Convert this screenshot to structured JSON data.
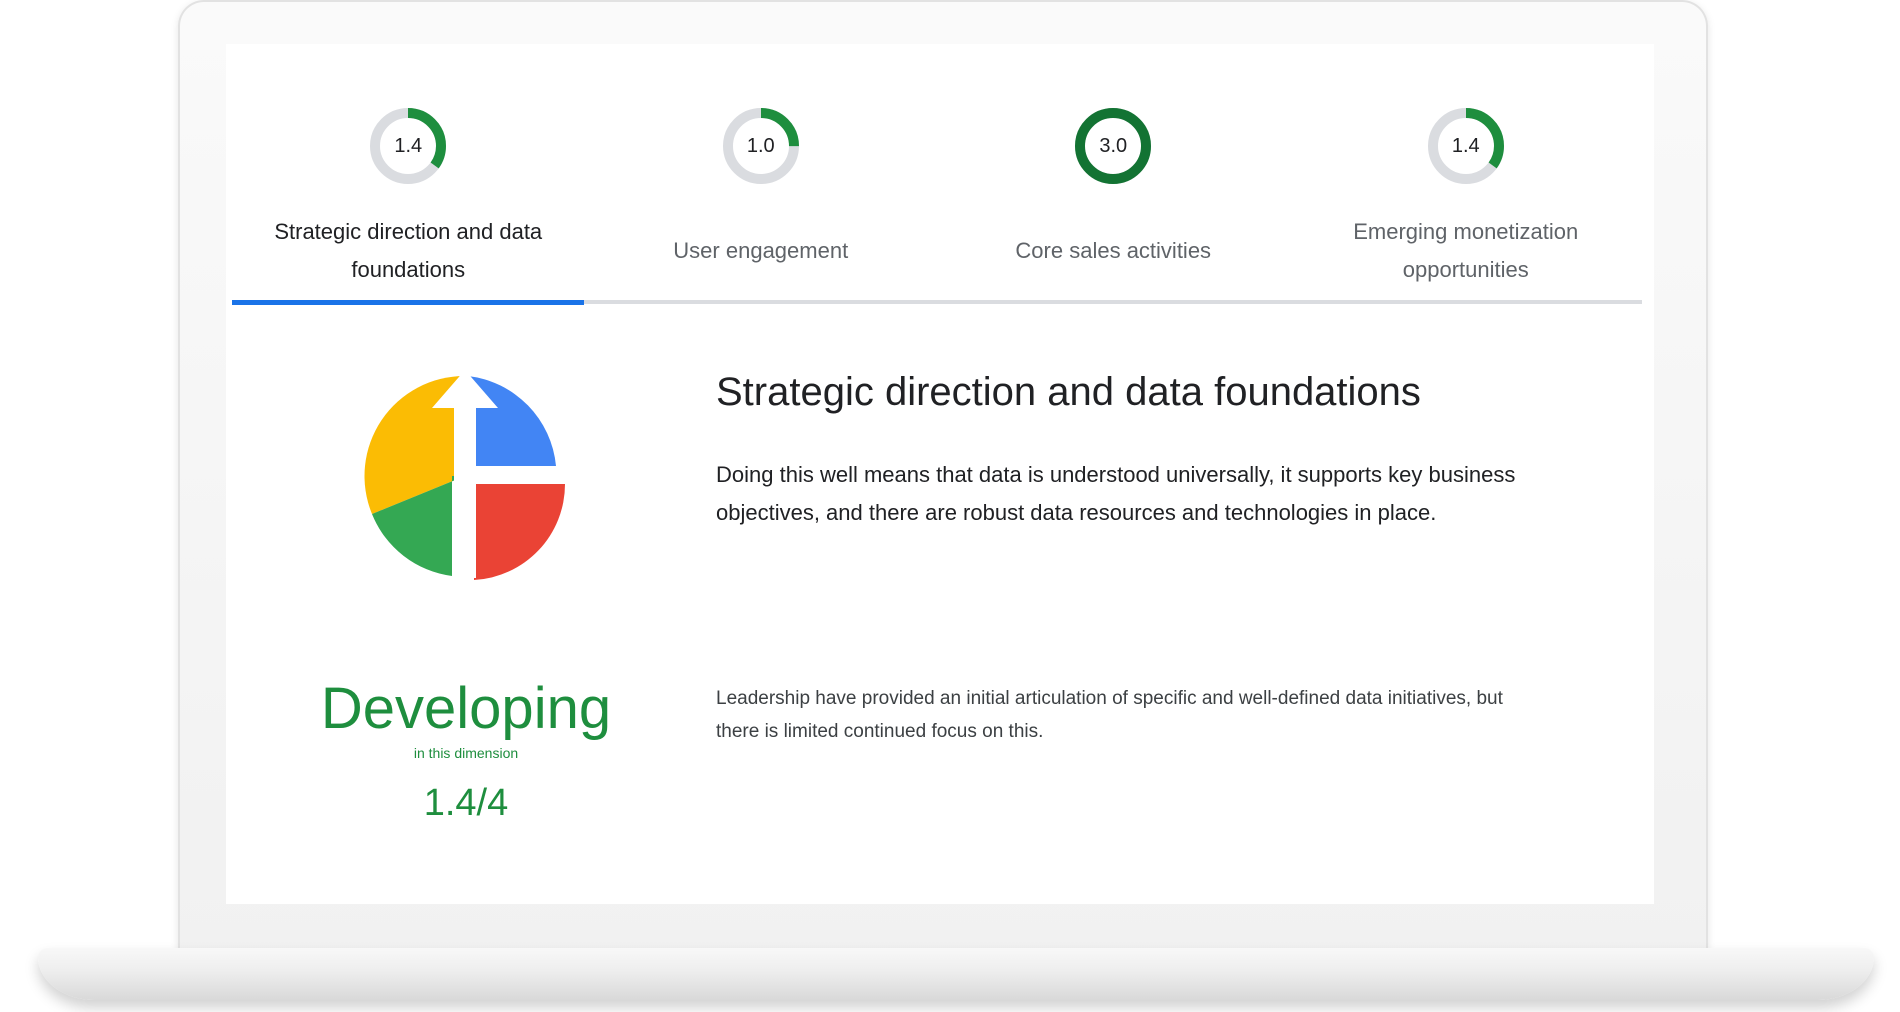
{
  "colors": {
    "ring_track": "#dadce0",
    "ring_progress": "#1e8e3e",
    "ring_progress_dark": "#137333",
    "tab_indicator": "#1a73e8",
    "level_text": "#1e8e3e",
    "google_blue": "#4285f4",
    "google_red": "#ea4335",
    "google_yellow": "#fbbc04",
    "google_green": "#34a853"
  },
  "tabs": [
    {
      "score": "1.4",
      "score_fraction": 0.35,
      "label": "Strategic direction and data foundations",
      "active": true
    },
    {
      "score": "1.0",
      "score_fraction": 0.25,
      "label": "User engagement",
      "active": false
    },
    {
      "score": "3.0",
      "score_fraction": 1.0,
      "label": "Core sales activities",
      "active": false
    },
    {
      "score": "1.4",
      "score_fraction": 0.35,
      "label": "Emerging monetization opportunities",
      "active": false
    }
  ],
  "detail": {
    "illustration_icon": "pie-chart-with-up-arrow-icon",
    "heading": "Strategic direction and data foundations",
    "description": "Doing this well means that data is understood universally, it supports key business objectives, and there are robust data resources and technologies in place.",
    "level": "Developing",
    "level_subtitle": "in this dimension",
    "score_text": "1.4/4",
    "finding": "Leadership have provided an initial articulation of specific and well-defined data initiatives, but there is limited continued focus on this."
  }
}
